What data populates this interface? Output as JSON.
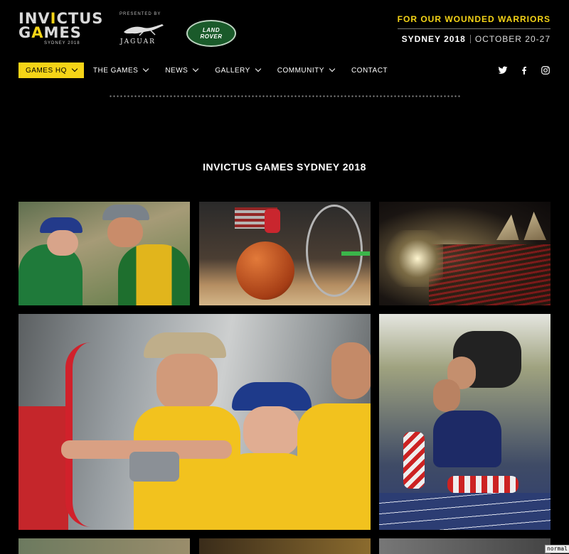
{
  "brand": {
    "logo_line1": "INVICTUS",
    "logo_line2": "GAMES",
    "logo_sub": "SYDNEY 2018",
    "presented_by": "PRESENTED BY",
    "sponsor1": "JAGUAR",
    "sponsor2_line1": "LAND",
    "sponsor2_line2": "ROVER",
    "accent_color": "#f5d417"
  },
  "slogan": {
    "tagline": "FOR OUR WOUNDED WARRIORS",
    "city": "SYDNEY 2018",
    "dates": "OCTOBER 20-27"
  },
  "nav": {
    "items": [
      {
        "label": "GAMES HQ",
        "active": true
      },
      {
        "label": "THE GAMES"
      },
      {
        "label": "NEWS"
      },
      {
        "label": "GALLERY"
      },
      {
        "label": "COMMUNITY"
      },
      {
        "label": "CONTACT"
      }
    ]
  },
  "social": [
    "twitter-icon",
    "facebook-icon",
    "instagram-icon"
  ],
  "page": {
    "title": "INVICTUS GAMES SYDNEY 2018"
  },
  "gallery": {
    "photos": [
      "athletes-embrace-photo",
      "wheelchair-basketball-photo",
      "opera-house-ceremony-photo",
      "archery-team-photo",
      "track-athletes-embrace-photo"
    ]
  },
  "badge": "normal"
}
